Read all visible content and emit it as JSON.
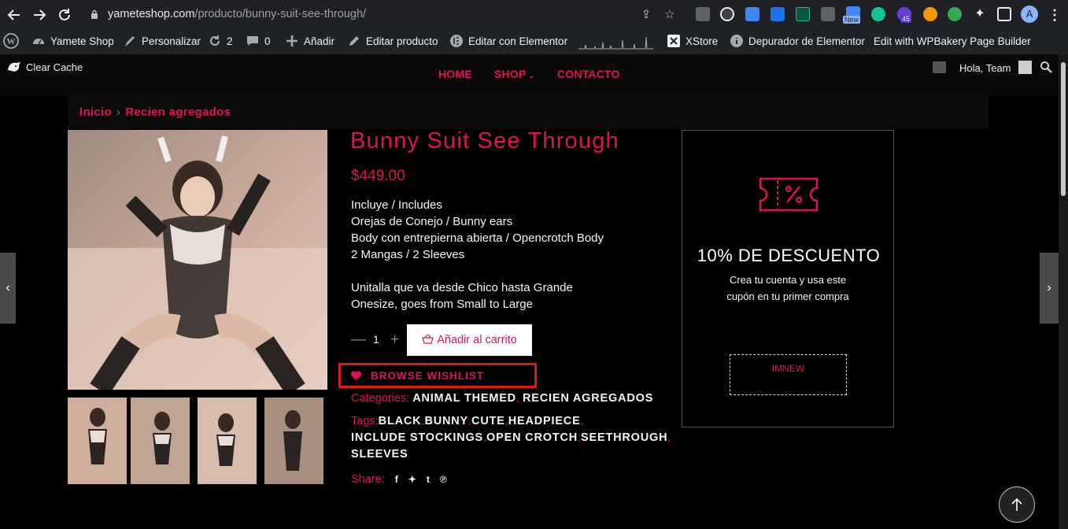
{
  "browser": {
    "url_host": "yameteshop.com",
    "url_path": "/producto/bunny-suit-see-through/",
    "profile_initial": "A",
    "badge_new": "New",
    "badge_count": "45"
  },
  "adminbar": {
    "site_name": "Yamete Shop",
    "customize": "Personalizar",
    "updates_count": "2",
    "comments_count": "0",
    "new": "Añadir",
    "edit_product": "Editar producto",
    "edit_elementor": "Editar con Elementor",
    "xstore": "XStore",
    "debugger": "Depurador de Elementor",
    "wpbakery": "Edit with WPBakery Page Builder",
    "clear_cache": "Clear Cache",
    "greeting": "Hola, Team"
  },
  "menu": {
    "home": "HOME",
    "shop": "SHOP",
    "contact": "CONTACTO"
  },
  "breadcrumb": {
    "home": "Inicio",
    "current": "Recien agregados"
  },
  "product": {
    "title": "Bunny Suit See Through",
    "price": "$449.00",
    "description": [
      "Incluye / Includes",
      "Orejas de Conejo / Bunny ears",
      "Body con entrepierna abierta / Opencrotch Body",
      "2 Mangas / 2 Sleeves",
      "",
      "Unitalla que va desde Chico hasta Grande",
      "Onesize, goes from Small to Large"
    ],
    "quantity": "1",
    "add_to_cart": "Añadir al carrito",
    "wishlist": "BROWSE WISHLIST",
    "categories_label": "Categories:",
    "categories": [
      "ANIMAL THEMED",
      "RECIEN AGREGADOS"
    ],
    "tags_label": "Tags:",
    "tags_line1": [
      "BLACK",
      "BUNNY",
      "CUTE",
      "HEADPIECE"
    ],
    "tags_line2": [
      "INCLUDE STOCKINGS",
      "OPEN CROTCH",
      "SEETHROUGH"
    ],
    "tags_line3": [
      "SLEEVES"
    ],
    "share_label": "Share:"
  },
  "promo": {
    "title": "10% DE DESCUENTO",
    "text": "Crea tu cuenta y usa este cupón en tu primer compra",
    "coupon": "IMNEW"
  },
  "colors": {
    "accent": "#e0105a",
    "highlight_box": "#e01920"
  }
}
